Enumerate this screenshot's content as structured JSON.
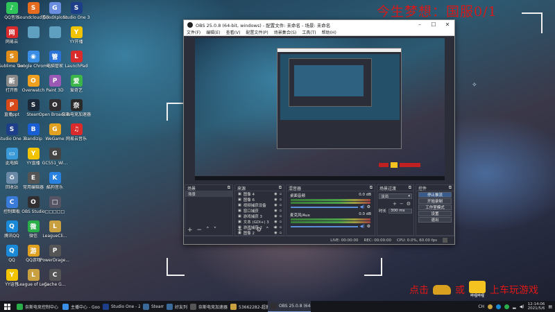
{
  "banner": {
    "text": "今生梦想：国服0/1"
  },
  "promo": {
    "click": "点击",
    "or": "或",
    "badge": "哔哩哔哩",
    "tail": "上车玩游戏"
  },
  "desktop_icons": [
    {
      "label": "QQ音乐",
      "color": "#2ec45a",
      "glyph": "♪"
    },
    {
      "label": "Soundcloud音乐",
      "color": "#e56b1f",
      "glyph": "S"
    },
    {
      "label": "GoodXplore",
      "color": "#6b8de0",
      "glyph": "G"
    },
    {
      "label": "Studio One 3",
      "color": "#1d3f8a",
      "glyph": "S"
    },
    {
      "label": "网易云",
      "color": "#d92b2b",
      "glyph": "网"
    },
    {
      "label": "",
      "color": "#5fa0c0",
      "glyph": ""
    },
    {
      "label": "",
      "color": "#5fa0c0",
      "glyph": ""
    },
    {
      "label": "YY开播",
      "color": "#f2c400",
      "glyph": "Y"
    },
    {
      "label": "Sublime Text",
      "color": "#e08c1a",
      "glyph": "S"
    },
    {
      "label": "Google Chrome",
      "color": "#3a8ee6",
      "glyph": "◉"
    },
    {
      "label": "电脑管家",
      "color": "#2a73d8",
      "glyph": "管"
    },
    {
      "label": "LaunchPad",
      "color": "#d92b2b",
      "glyph": "L"
    },
    {
      "label": "打开新",
      "color": "#888",
      "glyph": "新"
    },
    {
      "label": "Overwatch",
      "color": "#f0a020",
      "glyph": "O"
    },
    {
      "label": "Paint 3D",
      "color": "#9b59b6",
      "glyph": "P"
    },
    {
      "label": "爱奇艺",
      "color": "#3bb54a",
      "glyph": "爱"
    },
    {
      "label": "直播ppt",
      "color": "#d94a1a",
      "glyph": "P"
    },
    {
      "label": "Steam",
      "color": "#1b2838",
      "glyph": "S"
    },
    {
      "label": "Open Broadcast...",
      "color": "#302e31",
      "glyph": "O"
    },
    {
      "label": "奈斯电竞加速器",
      "color": "#2a2a2a",
      "glyph": "奈"
    },
    {
      "label": "Studio One 3",
      "color": "#1d3f8a",
      "glyph": "S"
    },
    {
      "label": "Bandizip",
      "color": "#1a5ed4",
      "glyph": "B"
    },
    {
      "label": "WeGame",
      "color": "#e0a020",
      "glyph": "G"
    },
    {
      "label": "网易云音乐",
      "color": "#d92b2b",
      "glyph": "♫"
    },
    {
      "label": "此电脑",
      "color": "#3a9ad8",
      "glyph": "▭"
    },
    {
      "label": "YY直播",
      "color": "#f2c400",
      "glyph": "Y"
    },
    {
      "label": "GC551_Wi...",
      "color": "#444",
      "glyph": "G"
    },
    {
      "label": "",
      "color": "",
      "glyph": ""
    },
    {
      "label": "回收站",
      "color": "#6a8aa8",
      "glyph": "♻"
    },
    {
      "label": "常用编辑器",
      "color": "#555",
      "glyph": "E"
    },
    {
      "label": "酷狗音乐",
      "color": "#2a82e0",
      "glyph": "K"
    },
    {
      "label": "",
      "color": "",
      "glyph": ""
    },
    {
      "label": "控制面板",
      "color": "#3a7ad8",
      "glyph": "C"
    },
    {
      "label": "OBS Studio",
      "color": "#302e31",
      "glyph": "O"
    },
    {
      "label": "□□□□□",
      "color": "#556",
      "glyph": "□"
    },
    {
      "label": "",
      "color": "",
      "glyph": ""
    },
    {
      "label": "腾讯QQ",
      "color": "#1a8ad8",
      "glyph": "Q"
    },
    {
      "label": "微信",
      "color": "#2aae4a",
      "glyph": "微"
    },
    {
      "label": "LeagueCli...",
      "color": "#c8a040",
      "glyph": "L"
    },
    {
      "label": "",
      "color": "",
      "glyph": ""
    },
    {
      "label": "QQ",
      "color": "#1a8ad8",
      "glyph": "Q"
    },
    {
      "label": "QQ游戏",
      "color": "#e0a020",
      "glyph": "游"
    },
    {
      "label": "PowerDrage...",
      "color": "#555",
      "glyph": "P"
    },
    {
      "label": "",
      "color": "",
      "glyph": ""
    },
    {
      "label": "YY语音",
      "color": "#f2c400",
      "glyph": "Y"
    },
    {
      "label": "League of Legends",
      "color": "#c8a040",
      "glyph": "L"
    },
    {
      "label": "Cache G...",
      "color": "#555",
      "glyph": "C"
    }
  ],
  "obs": {
    "title": "OBS 25.0.8 (64-bit, windows) - 配置文件: 未命名 - 场景: 未命名",
    "menu": [
      "文件(F)",
      "编辑(E)",
      "查看(V)",
      "配置文件(P)",
      "场景集合(S)",
      "工具(T)",
      "帮助(H)"
    ],
    "scenes_header": "场景",
    "scenes": [
      "场景"
    ],
    "sources_header": "来源",
    "sources": [
      "图像 4",
      "图像 6",
      "视频捕获设备",
      "窗口捕获",
      "游戏捕获 3",
      "文本 (GDI+) 3",
      "游戏捕获 2",
      "图像 2"
    ],
    "mixer_header": "混音器",
    "mixer": [
      {
        "name": "桌面音频",
        "level": "0.0 dB"
      },
      {
        "name": "麦克风/Aux",
        "level": "0.0 dB"
      }
    ],
    "transitions_header": "场景过渡",
    "transition_type": "淡出",
    "duration_label": "时长",
    "duration_value": "300 ms",
    "controls_header": "控件",
    "controls": [
      "停止推流",
      "开始录制",
      "工作室模式",
      "设置",
      "退出"
    ],
    "status": {
      "live": "LIVE: 00:00:00",
      "rec": "REC: 00:00:00",
      "cpu": "CPU: 0.0%, 60.00 fps"
    }
  },
  "taskbar": {
    "items": [
      {
        "label": "奈斯电竞控制中心",
        "color": "#2aae4a"
      },
      {
        "label": "主播中心 - Googl...",
        "color": "#3a8ee6"
      },
      {
        "label": "Studio One - 202...",
        "color": "#1d3f8a"
      },
      {
        "label": "Steam",
        "color": "#3a6a9a"
      },
      {
        "label": "好友列表",
        "color": "#3a6a9a"
      },
      {
        "label": "奈斯电竞加速器",
        "color": "#555"
      },
      {
        "label": "53662282-超激的...",
        "color": "#c8a040"
      },
      {
        "label": "OBS 25.0.8 (64-bi...",
        "color": "#302e31",
        "active": true
      }
    ],
    "tray_text": "CH",
    "time": "12:14:06",
    "date": "2021/5/6"
  }
}
